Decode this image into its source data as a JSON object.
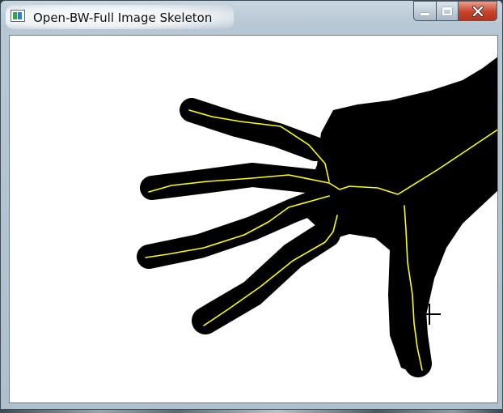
{
  "window": {
    "title": "Open-BW-Full Image Skeleton",
    "buttons": [
      "minimize",
      "maximize",
      "close"
    ]
  },
  "image": {
    "description_icon": "hand-silhouette",
    "silhouette_color": "#000000",
    "skeleton_color": "#ffff00",
    "background_color": "#ffffff"
  },
  "cursor": {
    "icon": "crosshair-cursor-icon"
  }
}
